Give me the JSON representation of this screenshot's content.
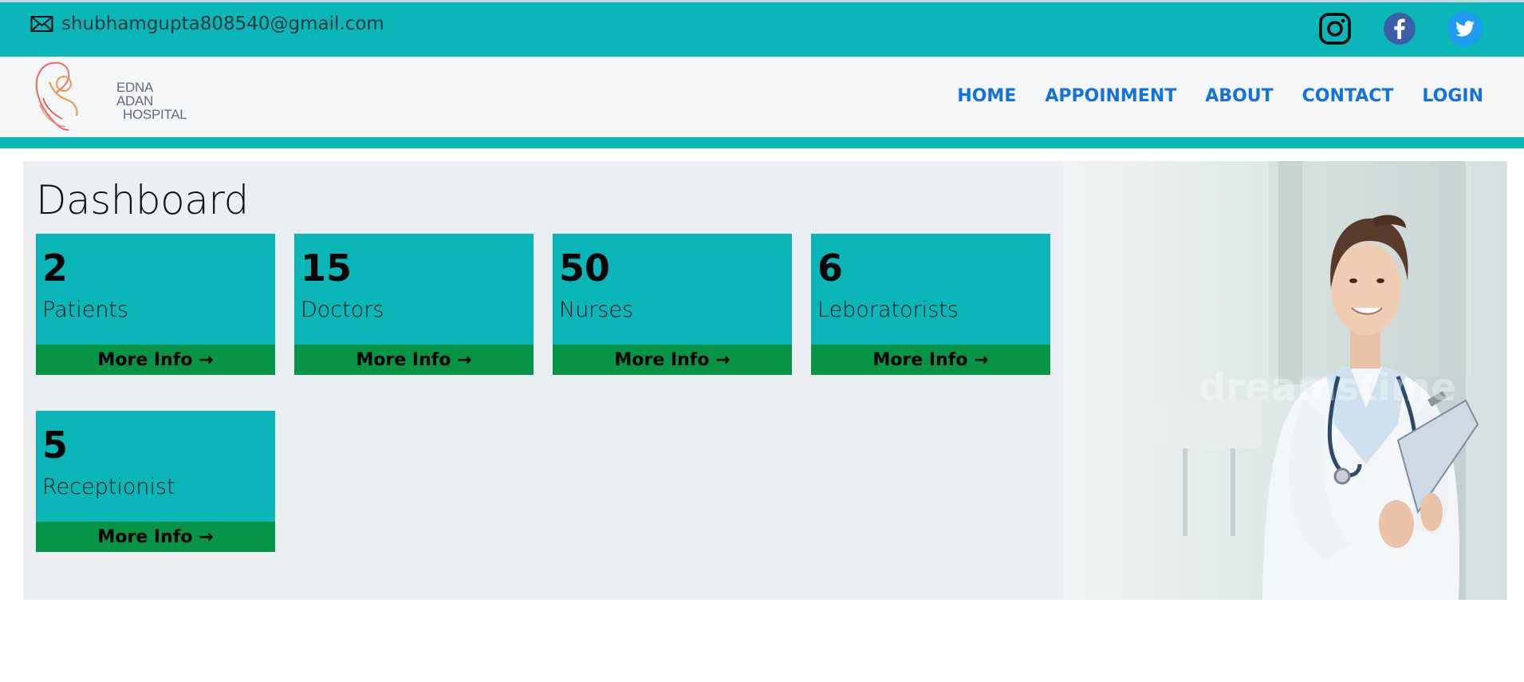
{
  "topbar": {
    "email": "shubhamgupta808540@gmail.com",
    "icons": [
      "mail-icon",
      "instagram-icon",
      "facebook-icon",
      "twitter-icon"
    ]
  },
  "logo": {
    "line1": "EDNA ADAN",
    "line2": "HOSPITAL"
  },
  "nav": {
    "items": [
      "HOME",
      "APPOINMENT",
      "ABOUT",
      "CONTACT",
      "LOGIN"
    ]
  },
  "dashboard": {
    "title": "Dashboard",
    "more_label": "More Info →",
    "cards": [
      {
        "count": "2",
        "label": "Patients"
      },
      {
        "count": "15",
        "label": "Doctors"
      },
      {
        "count": "50",
        "label": "Nurses"
      },
      {
        "count": "6",
        "label": "Leboratorists"
      },
      {
        "count": "5",
        "label": "Receptionist"
      }
    ]
  },
  "colors": {
    "accent": "#0bb6b8",
    "more_bar": "#079447",
    "nav_link": "#1173e3",
    "panel_bg": "#ebeff3"
  }
}
